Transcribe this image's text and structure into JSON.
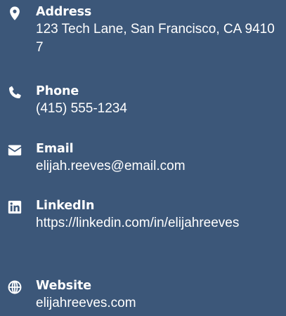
{
  "contact": {
    "address": {
      "label": "Address",
      "value": "123 Tech Lane, San Francisco, CA 94107",
      "icon": "map-marker-icon"
    },
    "phone": {
      "label": "Phone",
      "value": "(415) 555-1234",
      "icon": "phone-icon"
    },
    "email": {
      "label": "Email",
      "value": "elijah.reeves@email.com",
      "icon": "envelope-icon"
    },
    "linkedin": {
      "label": "LinkedIn",
      "value": "https://linkedin.com/in/elijahreeves",
      "icon": "linkedin-icon"
    },
    "website": {
      "label": "Website",
      "value": "elijahreeves.com",
      "icon": "globe-icon"
    }
  },
  "colors": {
    "background": "#3c5779",
    "text": "#ffffff"
  }
}
